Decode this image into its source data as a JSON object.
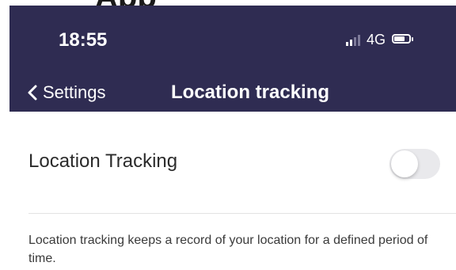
{
  "top_title_partial": "App",
  "status_bar": {
    "time": "18:55",
    "network": "4G",
    "signal_icon": "signal-icon",
    "battery_icon": "battery-icon"
  },
  "nav_bar": {
    "back_label": "Settings",
    "back_icon": "chevron-left-icon",
    "title": "Location tracking",
    "background_color": "#2f2c52"
  },
  "setting": {
    "label": "Location Tracking",
    "toggle_state": "off"
  },
  "description": "Location tracking keeps a record of your location for a defined period of time."
}
